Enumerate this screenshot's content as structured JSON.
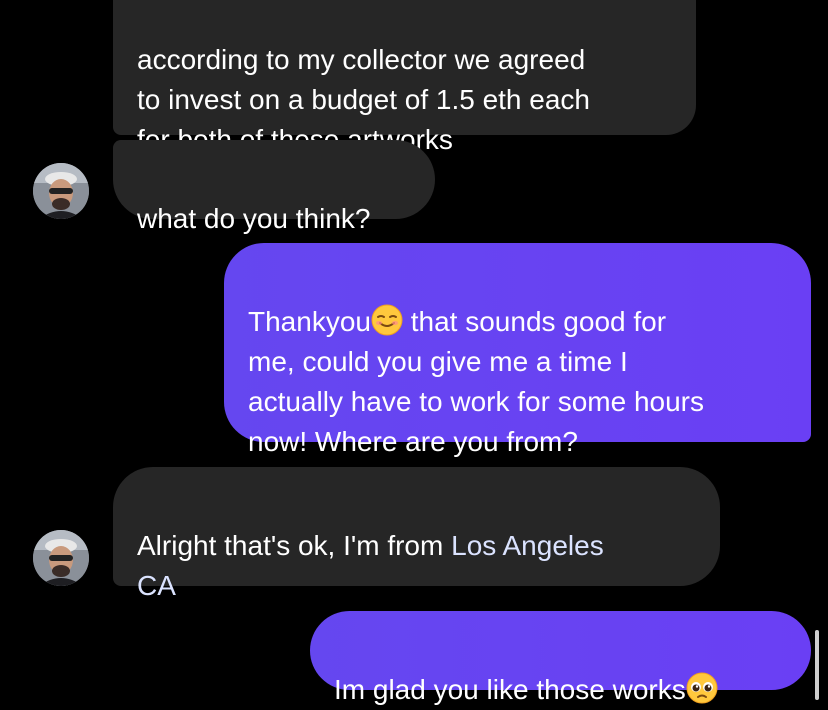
{
  "messages": [
    {
      "sender": "other",
      "text": "according to my collector we agreed\nto invest on a budget of 1.5 eth each\nfor both of these artworks"
    },
    {
      "sender": "other",
      "text": "what do you think?"
    },
    {
      "sender": "me",
      "text_part1": "Thankyou",
      "emoji1": "relieved-face-emoji",
      "text_part2": " that sounds good for\nme, could you give me a time I\nactually have to work for some hours\nnow! Where are you from?"
    },
    {
      "sender": "other",
      "text_part1": "Alright that's ok, I'm from ",
      "link": "Los Angeles\nCA"
    },
    {
      "sender": "me",
      "text": "Im glad you like those works",
      "emoji": "pleading-face-emoji"
    }
  ],
  "colors": {
    "background": "#000000",
    "incoming_bubble": "#262626",
    "outgoing_bubble": "#6a40f3",
    "text": "#ffffff",
    "link": "#dbe3ff"
  },
  "avatar": {
    "icon": "user-avatar-photo"
  }
}
